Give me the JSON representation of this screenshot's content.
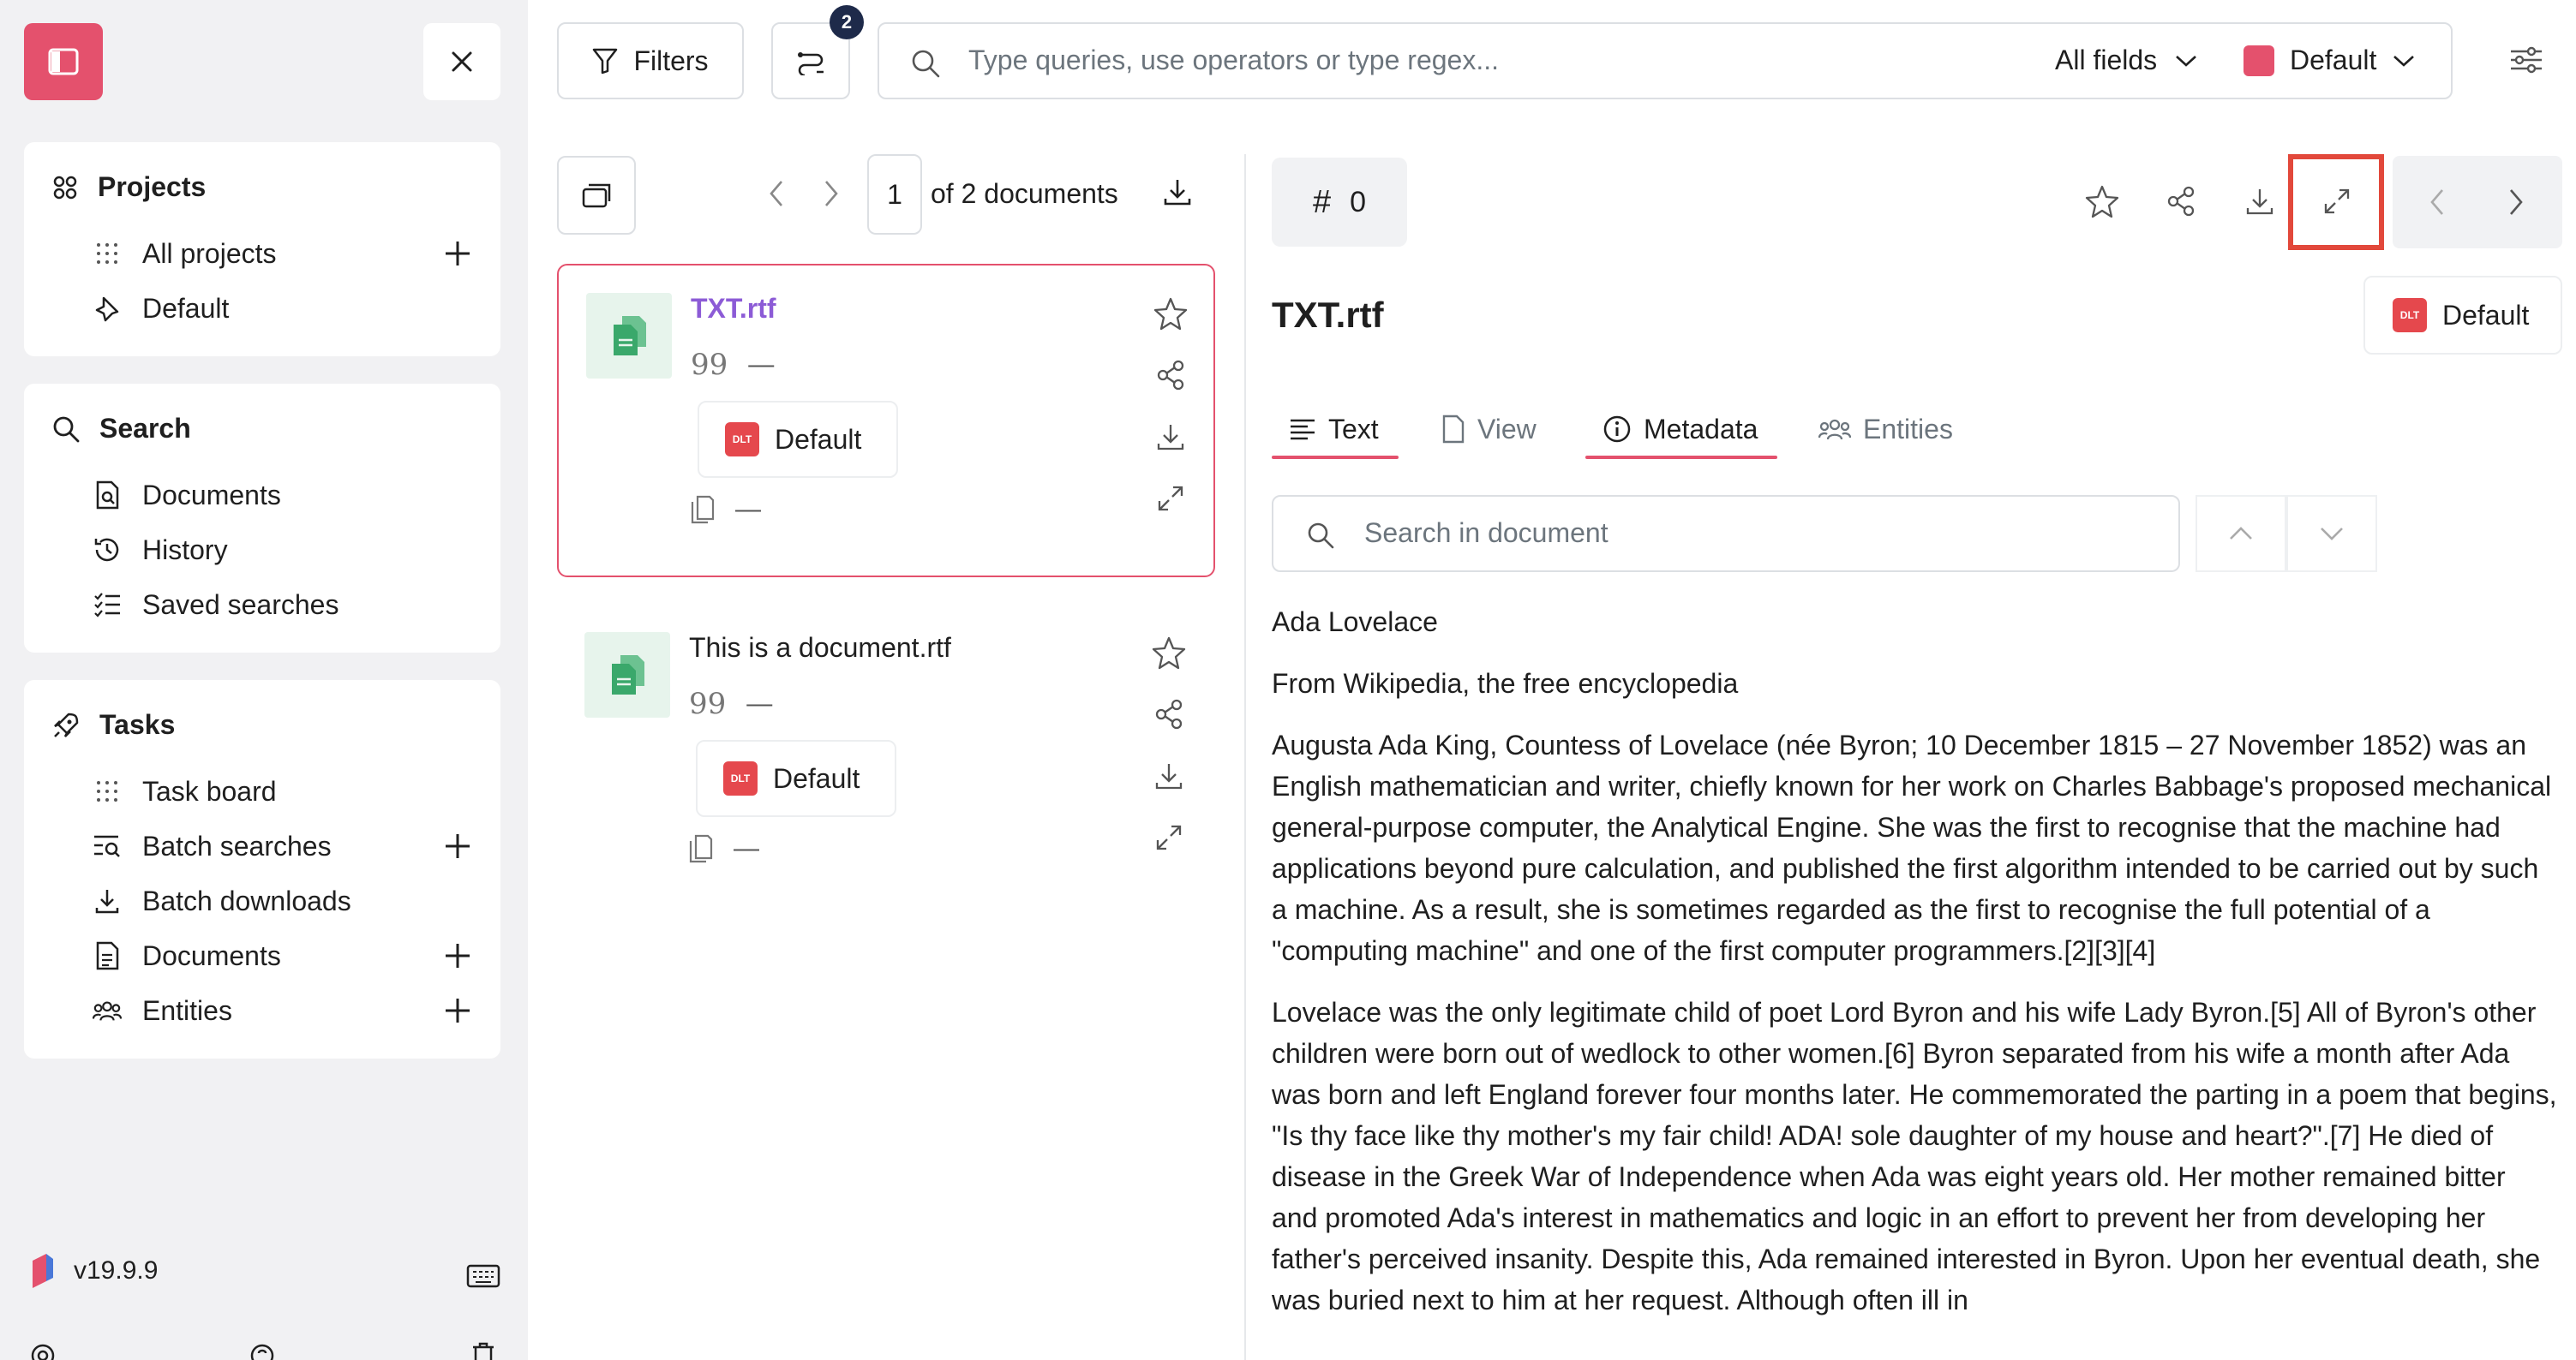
{
  "sidebar": {
    "projects": {
      "title": "Projects",
      "items": [
        {
          "label": "All projects",
          "icon": "grid-dots-icon",
          "has_add": true
        },
        {
          "label": "Default",
          "icon": "pin-icon",
          "has_add": false
        }
      ]
    },
    "search": {
      "title": "Search",
      "items": [
        {
          "label": "Documents",
          "icon": "document-search-icon"
        },
        {
          "label": "History",
          "icon": "history-icon"
        },
        {
          "label": "Saved searches",
          "icon": "list-check-icon"
        }
      ]
    },
    "tasks": {
      "title": "Tasks",
      "items": [
        {
          "label": "Task board",
          "icon": "grid-dots-icon",
          "has_add": false
        },
        {
          "label": "Batch searches",
          "icon": "batch-search-icon",
          "has_add": true
        },
        {
          "label": "Batch downloads",
          "icon": "download-icon",
          "has_add": false
        },
        {
          "label": "Documents",
          "icon": "document-icon",
          "has_add": true
        },
        {
          "label": "Entities",
          "icon": "users-icon",
          "has_add": true
        }
      ]
    },
    "version": "v19.9.9"
  },
  "toolbar": {
    "filters_label": "Filters",
    "badge_count": "2",
    "search_placeholder": "Type queries, use operators or type regex...",
    "fields_label": "All fields",
    "project_label": "Default"
  },
  "list": {
    "page": "1",
    "of_label": "of 2 documents",
    "documents": [
      {
        "title": "TXT.rtf",
        "quote": "—",
        "project": "Default",
        "pages": "—",
        "selected": true
      },
      {
        "title": "This is a document.rtf",
        "quote": "—",
        "project": "Default",
        "pages": "—",
        "selected": false
      }
    ]
  },
  "viewer": {
    "hash_value": "0",
    "title": "TXT.rtf",
    "project": "Default",
    "tabs": [
      {
        "label": "Text",
        "active": true
      },
      {
        "label": "View",
        "active": false
      },
      {
        "label": "Metadata",
        "active": true
      },
      {
        "label": "Entities",
        "active": false
      }
    ],
    "search_placeholder": "Search in document",
    "paragraphs": [
      "Ada Lovelace",
      "From Wikipedia, the free encyclopedia",
      "Augusta Ada King, Countess of Lovelace (née Byron; 10 December 1815 – 27 November 1852) was an English mathematician and writer, chiefly known for her work on Charles Babbage's proposed mechanical general-purpose computer, the Analytical Engine. She was the first to recognise that the machine had applications beyond pure calculation, and published the first algorithm intended to be carried out by such a machine. As a result, she is sometimes regarded as the first to recognise the full potential of a \"computing machine\" and one of the first computer programmers.[2][3][4]",
      "Lovelace was the only legitimate child of poet Lord Byron and his wife Lady Byron.[5] All of Byron's other children were born out of wedlock to other women.[6] Byron separated from his wife a month after Ada was born and left England forever four months later. He commemorated the parting in a poem that begins, \"Is thy face like thy mother's my fair child! ADA! sole daughter of my house and heart?\".[7] He died of disease in the Greek War of Independence when Ada was eight years old. Her mother remained bitter and promoted Ada's interest in mathematics and logic in an effort to prevent her from developing her father's perceived insanity. Despite this, Ada remained interested in Byron. Upon her eventual death, she was buried next to him at her request. Although often ill in"
    ]
  },
  "colors": {
    "brand": "#e4516d",
    "selected_title": "#8c5bd6",
    "highlight_box": "#e2483b",
    "doc_icon": "#3aa86b"
  }
}
